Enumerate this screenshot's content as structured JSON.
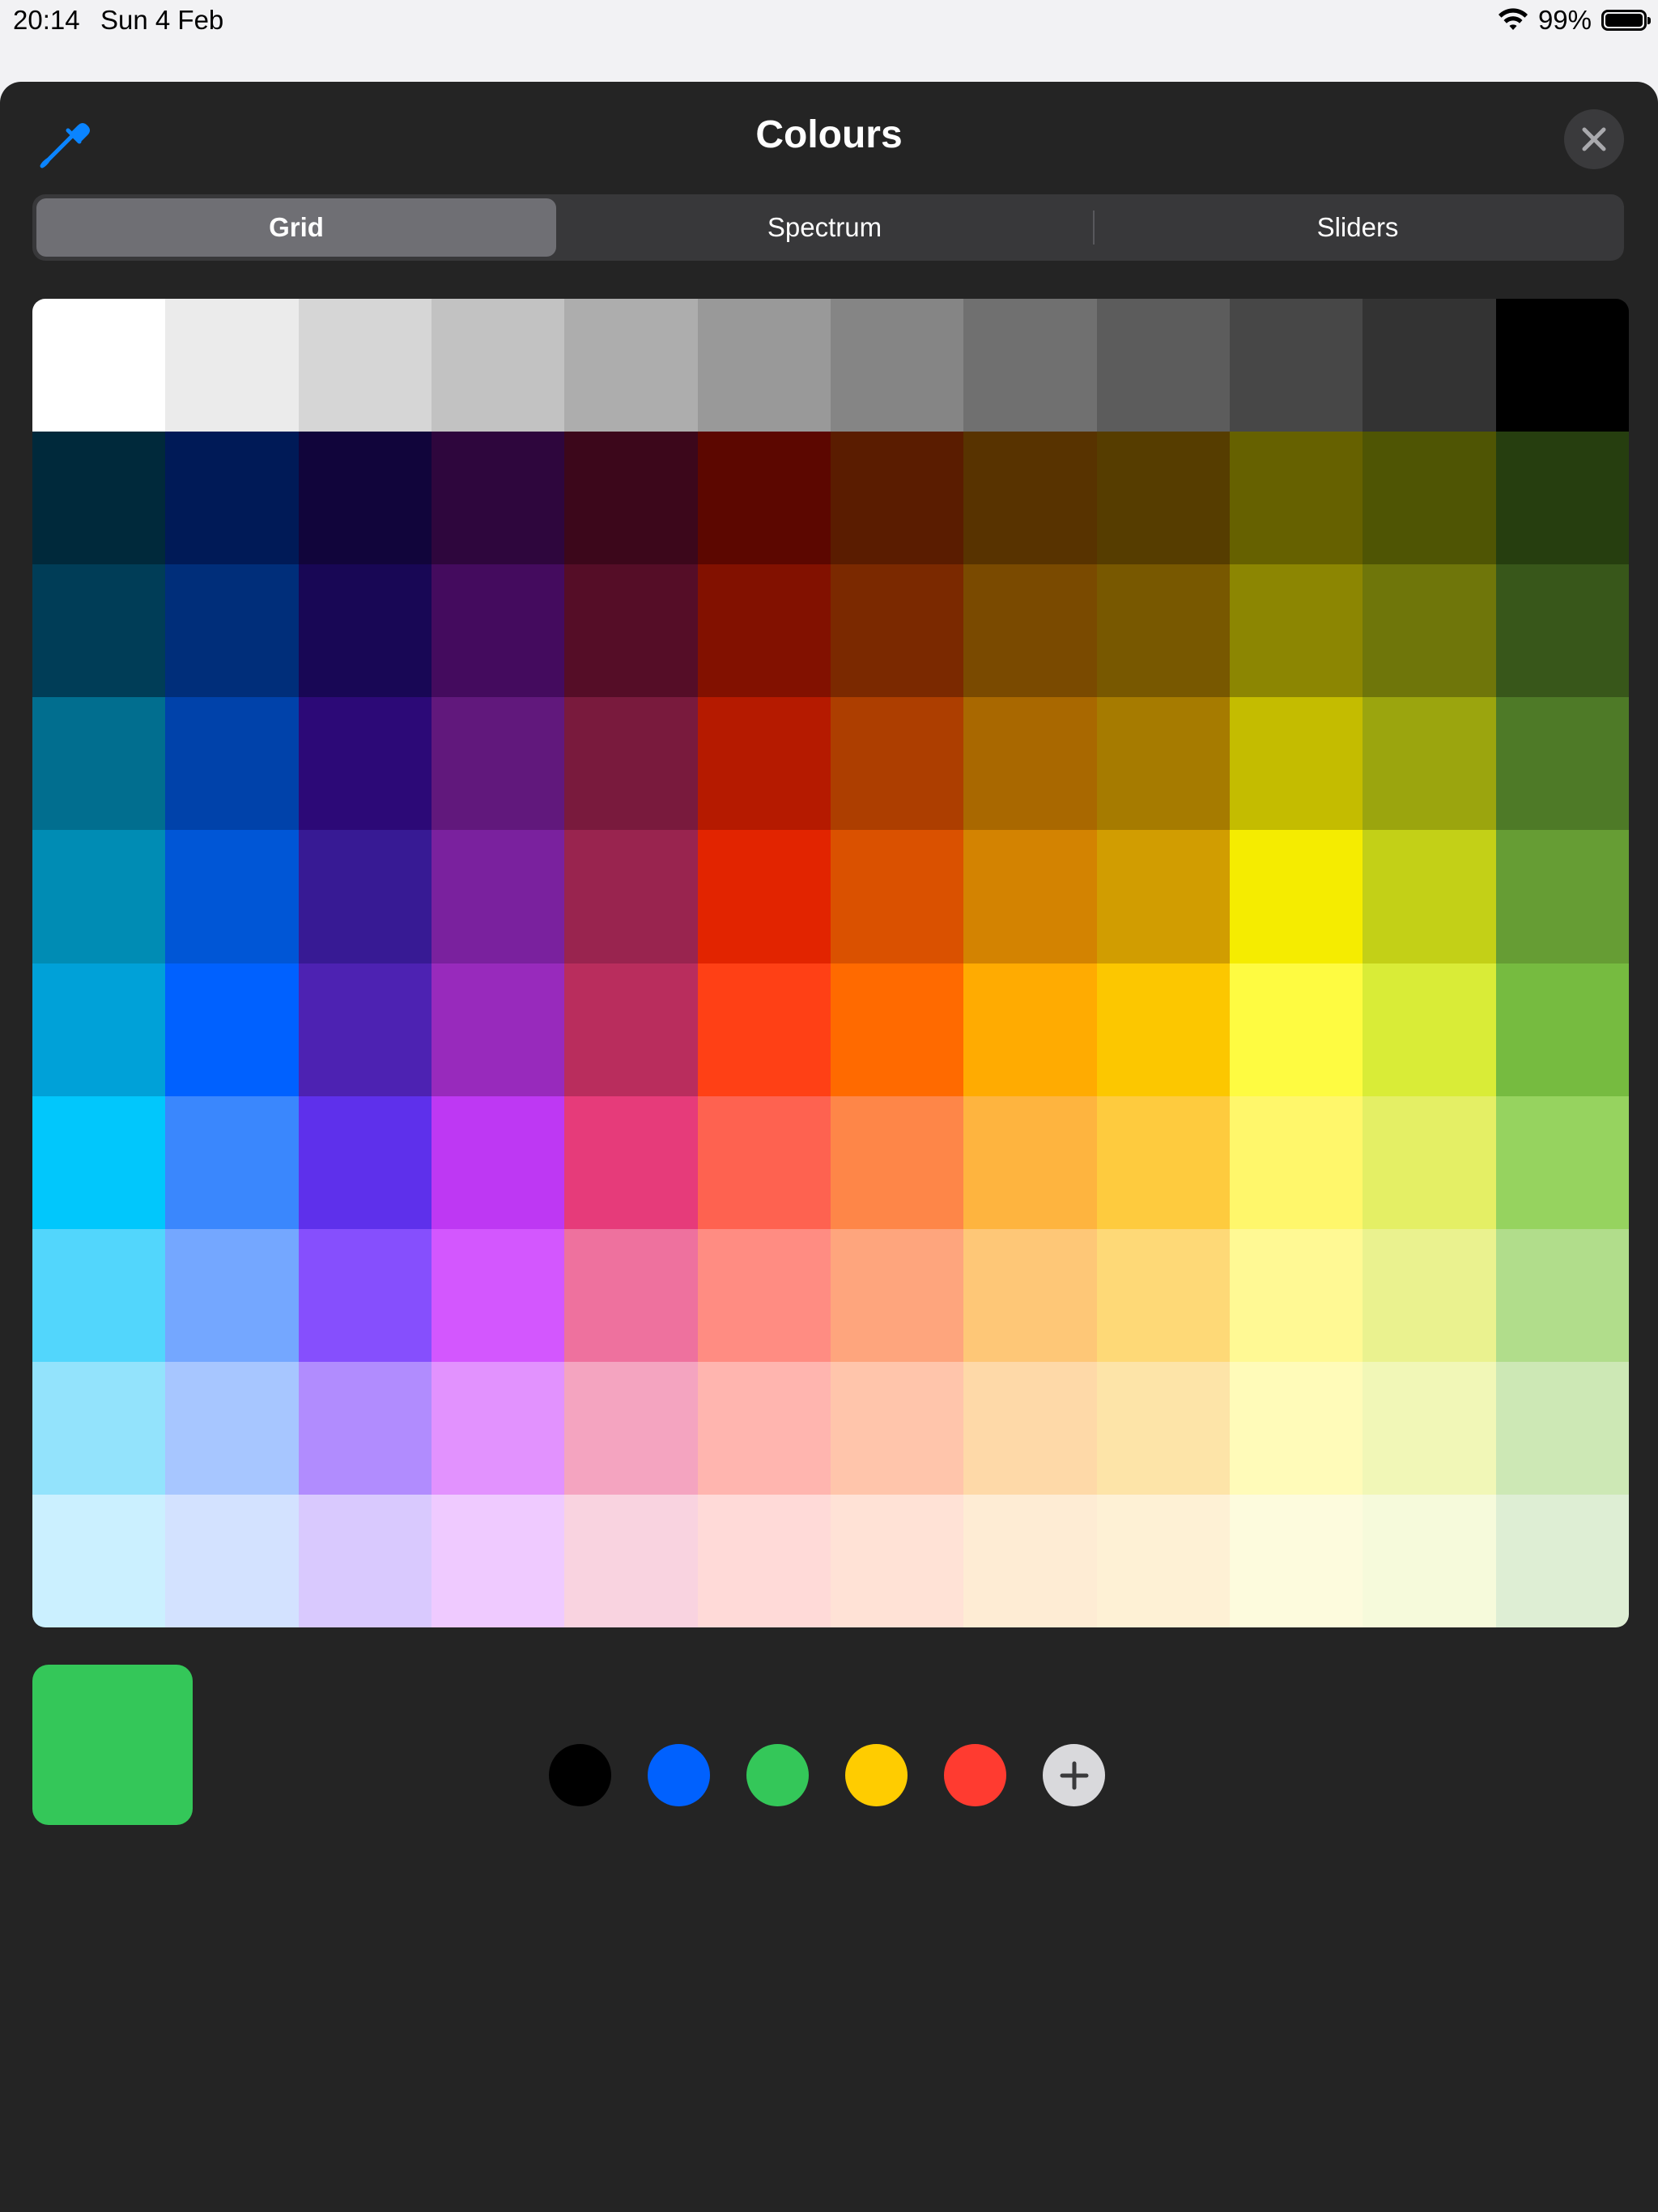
{
  "status": {
    "time": "20:14",
    "date": "Sun 4 Feb",
    "battery_text": "99%",
    "battery_level": 0.99
  },
  "header": {
    "title": "Colours",
    "eyedropper_icon": "eyedropper-icon",
    "close_icon": "close-icon",
    "accent_color": "#0a84ff"
  },
  "tabs": [
    {
      "label": "Grid",
      "selected": true
    },
    {
      "label": "Spectrum",
      "selected": false
    },
    {
      "label": "Sliders",
      "selected": false
    }
  ],
  "grid_colors": [
    [
      "#ffffff",
      "#ebebeb",
      "#d6d6d6",
      "#c2c2c2",
      "#adadad",
      "#999999",
      "#858585",
      "#707070",
      "#5c5c5c",
      "#474747",
      "#333333",
      "#000000"
    ],
    [
      "#00293b",
      "#001a57",
      "#11053b",
      "#2e063d",
      "#3c071b",
      "#5c0700",
      "#5a1c00",
      "#583300",
      "#563d00",
      "#666100",
      "#4f5504",
      "#263e0f"
    ],
    [
      "#003d57",
      "#002e7a",
      "#180755",
      "#440b5e",
      "#550d27",
      "#821100",
      "#7b2900",
      "#7a4a00",
      "#785800",
      "#8c8602",
      "#6f760a",
      "#38571a"
    ],
    [
      "#016e8f",
      "#0042aa",
      "#2c0977",
      "#61187c",
      "#791a3d",
      "#b51a00",
      "#ad3e00",
      "#a96800",
      "#a67b00",
      "#c4bc00",
      "#9ba50e",
      "#4e7a27"
    ],
    [
      "#008cb4",
      "#0056d6",
      "#371a94",
      "#7a219e",
      "#99244f",
      "#e22400",
      "#da5100",
      "#d38301",
      "#d19d01",
      "#f5ec00",
      "#c3d017",
      "#669d34"
    ],
    [
      "#00a1d8",
      "#0061ff",
      "#4d22b2",
      "#982abc",
      "#b92d5d",
      "#ff4015",
      "#ff6a00",
      "#ffab01",
      "#fcc700",
      "#fefb41",
      "#d9ec37",
      "#76bb40"
    ],
    [
      "#01c7fc",
      "#3a87fd",
      "#5e30eb",
      "#be38f3",
      "#e63b7a",
      "#fe6250",
      "#fe8648",
      "#feb43f",
      "#fecb3e",
      "#fff76b",
      "#e4ef65",
      "#96d35f"
    ],
    [
      "#52d6fc",
      "#74a7ff",
      "#864ffd",
      "#d357fe",
      "#ee719e",
      "#ff8c82",
      "#fea57d",
      "#fec777",
      "#fed977",
      "#fff994",
      "#eaf28f",
      "#b1dd8b"
    ],
    [
      "#93e3fc",
      "#a7c6ff",
      "#b18cfe",
      "#e292fe",
      "#f4a4c0",
      "#ffb5af",
      "#ffc5ab",
      "#fed9a8",
      "#fde4a8",
      "#fffbb9",
      "#f1f7b7",
      "#cde8b5"
    ],
    [
      "#cbf0ff",
      "#d3e2ff",
      "#d9c9fe",
      "#efcaff",
      "#f9d3e0",
      "#ffdad8",
      "#ffe2d6",
      "#feecd4",
      "#fef1d5",
      "#fdfbdd",
      "#f6fadb",
      "#deeed4"
    ]
  ],
  "current_color": "#34c759",
  "favorites": [
    {
      "name": "black",
      "color": "#000000"
    },
    {
      "name": "blue",
      "color": "#0061fe"
    },
    {
      "name": "green",
      "color": "#34c759"
    },
    {
      "name": "yellow",
      "color": "#ffcc00"
    },
    {
      "name": "red",
      "color": "#ff3b30"
    }
  ],
  "add_icon": "plus-icon"
}
